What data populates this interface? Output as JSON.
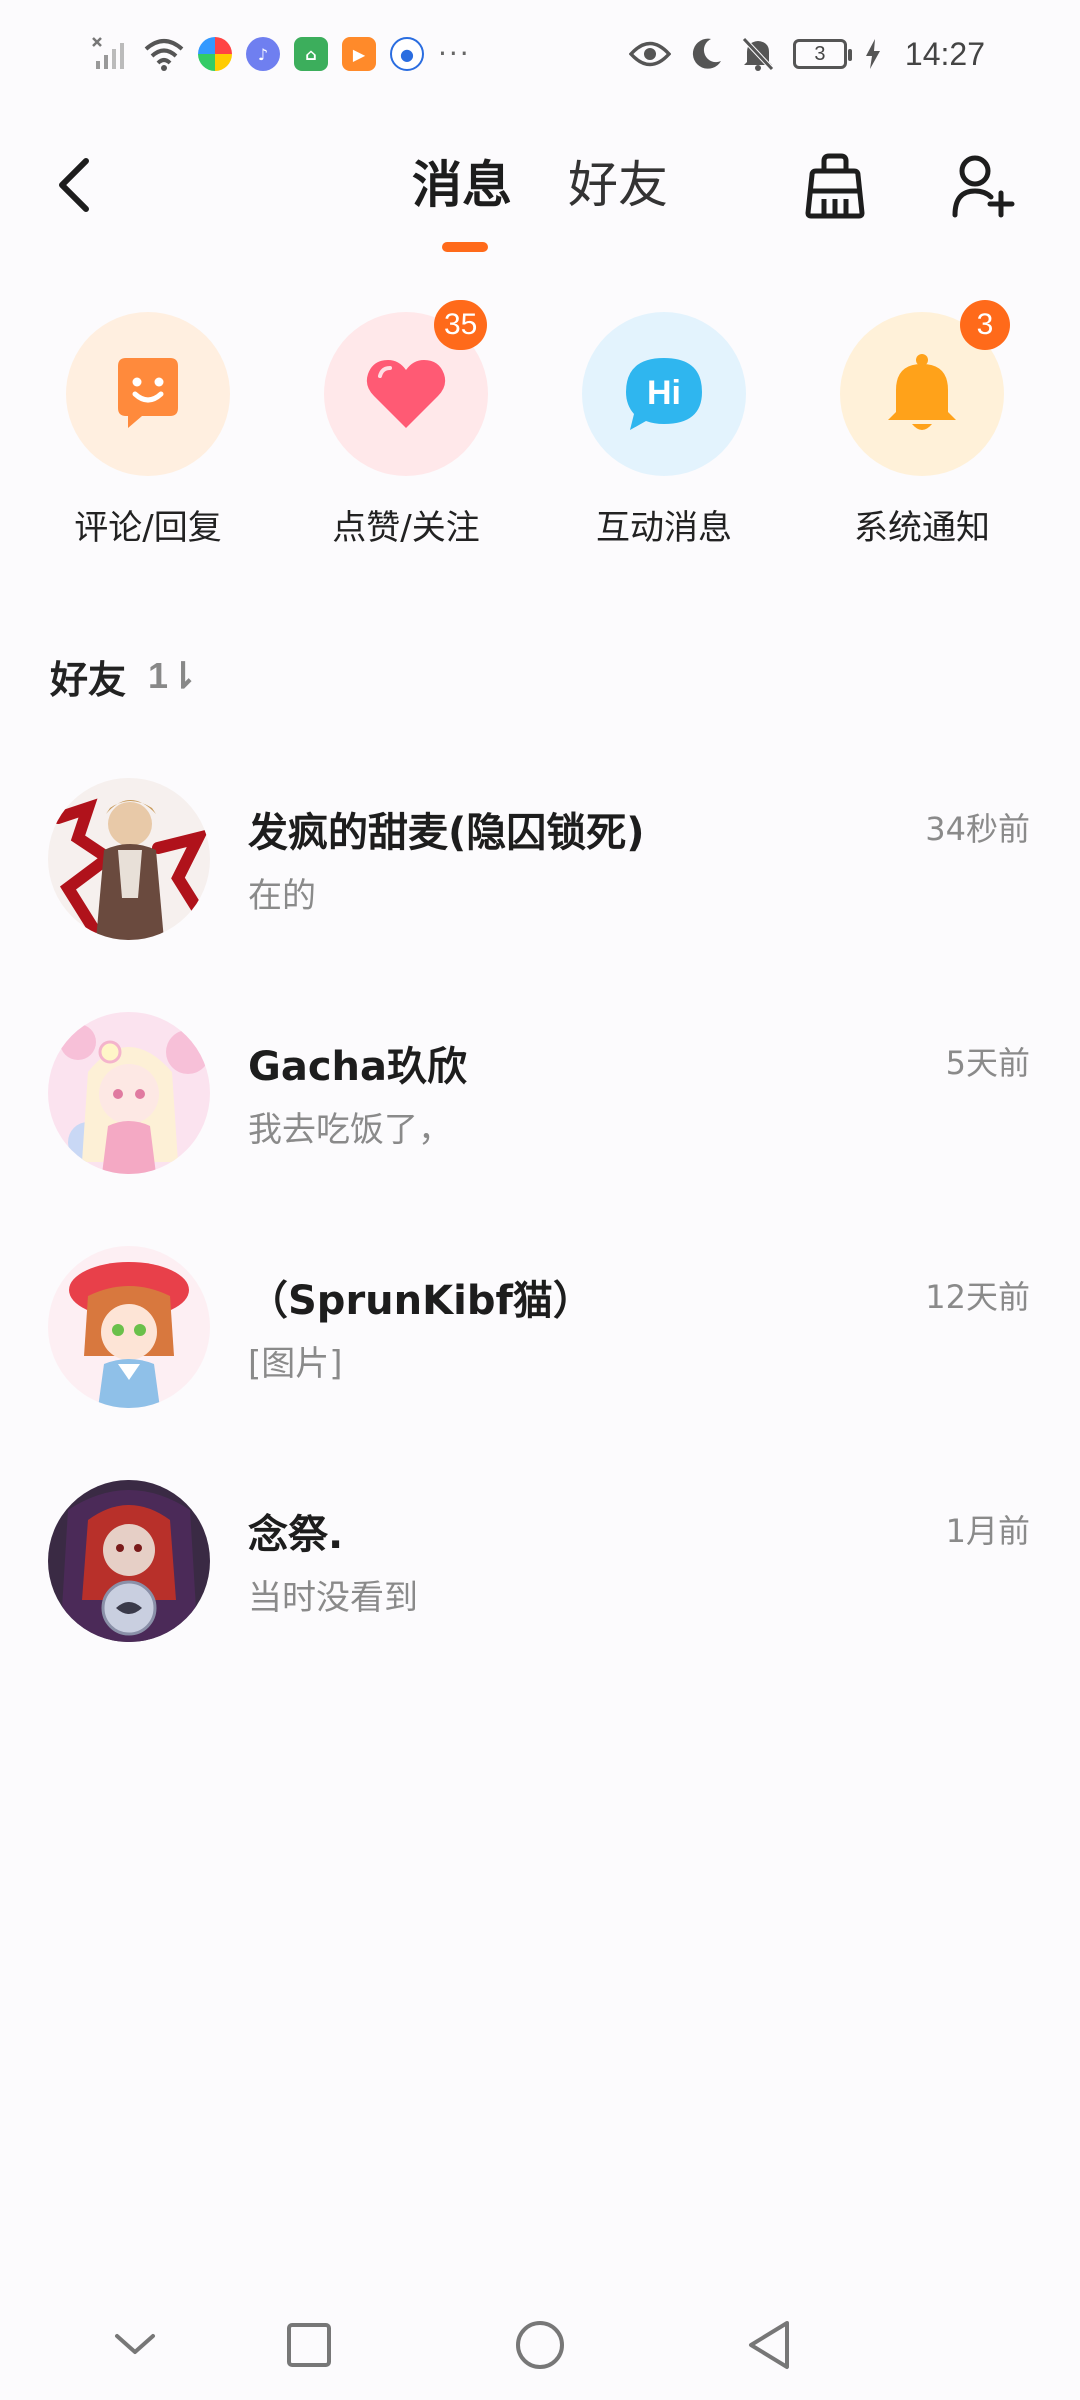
{
  "status_bar": {
    "time": "14:27",
    "battery_level": "3",
    "overflow_dots": "···",
    "icons": [
      "no-signal-icon",
      "wifi-icon",
      "app-icon-1",
      "app-icon-2",
      "app-icon-3",
      "app-icon-4",
      "app-icon-5",
      "eye-icon",
      "moon-icon",
      "bell-off-icon",
      "battery-icon",
      "charging-icon"
    ]
  },
  "header": {
    "tabs": [
      {
        "label": "消息",
        "active": true
      },
      {
        "label": "好友",
        "active": false
      }
    ],
    "accent_color": "#ff6a1a"
  },
  "shortcuts": [
    {
      "label": "评论/回复",
      "icon": "comment-smile-icon",
      "badge": null,
      "bg": "#ffefe0"
    },
    {
      "label": "点赞/关注",
      "icon": "heart-icon",
      "badge": "35",
      "bg": "#ffe8ea"
    },
    {
      "label": "互动消息",
      "icon": "hi-bubble-icon",
      "badge": null,
      "bg": "#e3f3fd"
    },
    {
      "label": "系统通知",
      "icon": "bell-icon",
      "badge": "3",
      "bg": "#fff1d9"
    }
  ],
  "friends_section": {
    "title": "好友",
    "sort_glyph": "1⇂"
  },
  "conversations": [
    {
      "name": "发疯的甜麦(隐囚锁死)",
      "preview": "在的",
      "time": "34秒前"
    },
    {
      "name": "Gacha玖欣",
      "preview": "我去吃饭了，",
      "time": "5天前"
    },
    {
      "name": "（SprunKibf猫）",
      "preview": "[图片]",
      "time": "12天前"
    },
    {
      "name": "念祭.",
      "preview": "当时没看到",
      "time": "1月前"
    }
  ]
}
